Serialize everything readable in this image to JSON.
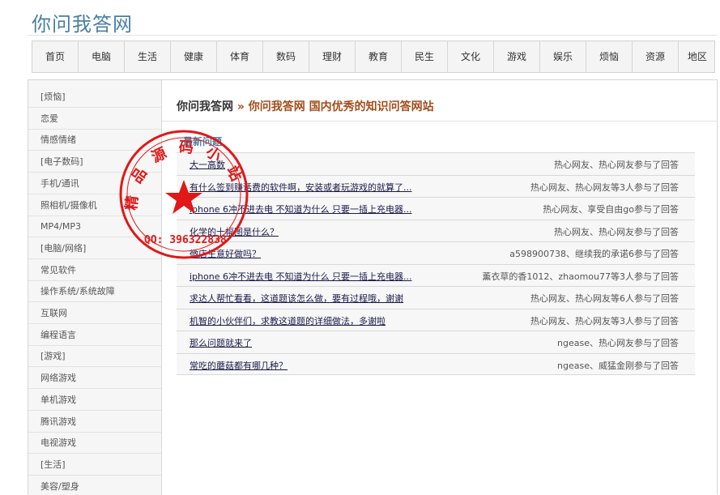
{
  "site": {
    "logo": "你问我答网"
  },
  "nav": [
    "首页",
    "电脑",
    "生活",
    "健康",
    "体育",
    "数码",
    "理财",
    "教育",
    "民生",
    "文化",
    "游戏",
    "娱乐",
    "烦恼",
    "资源",
    "地区"
  ],
  "sidebar": [
    {
      "label": "[烦恼]",
      "type": "cat"
    },
    {
      "label": "恋爱",
      "type": "link"
    },
    {
      "label": "情感情绪",
      "type": "link"
    },
    {
      "label": "[电子数码]",
      "type": "cat"
    },
    {
      "label": "手机/通讯",
      "type": "link"
    },
    {
      "label": "照相机/摄像机",
      "type": "link"
    },
    {
      "label": "MP4/MP3",
      "type": "link"
    },
    {
      "label": "[电脑/网络]",
      "type": "cat"
    },
    {
      "label": "常见软件",
      "type": "link"
    },
    {
      "label": "操作系统/系统故障",
      "type": "link"
    },
    {
      "label": "互联网",
      "type": "link"
    },
    {
      "label": "编程语言",
      "type": "link"
    },
    {
      "label": "[游戏]",
      "type": "cat"
    },
    {
      "label": "网络游戏",
      "type": "link"
    },
    {
      "label": "单机游戏",
      "type": "link"
    },
    {
      "label": "腾讯游戏",
      "type": "link"
    },
    {
      "label": "电视游戏",
      "type": "link"
    },
    {
      "label": "[生活]",
      "type": "cat"
    },
    {
      "label": "美容/塑身",
      "type": "link"
    }
  ],
  "breadcrumb": {
    "home": "你问我答网",
    "sep": "»",
    "current": "你问我答网 国内优秀的知识问答网站"
  },
  "section_title": "最新问题",
  "questions": [
    {
      "title": "大一高数",
      "meta": "热心网友、热心网友参与了回答"
    },
    {
      "title": "有什么签到赚话费的软件啊，安装或者玩游戏的就算了...",
      "meta": "热心网友、热心网友等3人参与了回答"
    },
    {
      "title": "iphone 6冲不进去电 不知道为什么 只要一插上充电器...",
      "meta": "热心网友、享受自由go参与了回答"
    },
    {
      "title": "化学的十幅图是什么？",
      "meta": "热心网友、热心网友参与了回答"
    },
    {
      "title": "微店生意好做吗？",
      "meta": "a598900738、继续我的承诺6参与了回答"
    },
    {
      "title": "iphone 6冲不进去电 不知道为什么 只要一插上充电器...",
      "meta": "薰衣草的香1012、zhaomou77等3人参与了回答"
    },
    {
      "title": "求达人帮忙看看，这道题该怎么做，要有过程哦，谢谢",
      "meta": "热心网友、热心网友等6人参与了回答"
    },
    {
      "title": "机智的小伙伴们，求教这道题的详细做法，多谢啦",
      "meta": "热心网友、热心网友等3人参与了回答"
    },
    {
      "title": "那么问题就来了",
      "meta": "ngease、热心网友参与了回答"
    },
    {
      "title": "常吃的蘑菇都有哪几种？",
      "meta": "ngease、威猛金刚参与了回答"
    }
  ],
  "watermark": {
    "arc_text": "精品源码小站",
    "qq": "QQ: 396322838",
    "color": "#e01818"
  }
}
